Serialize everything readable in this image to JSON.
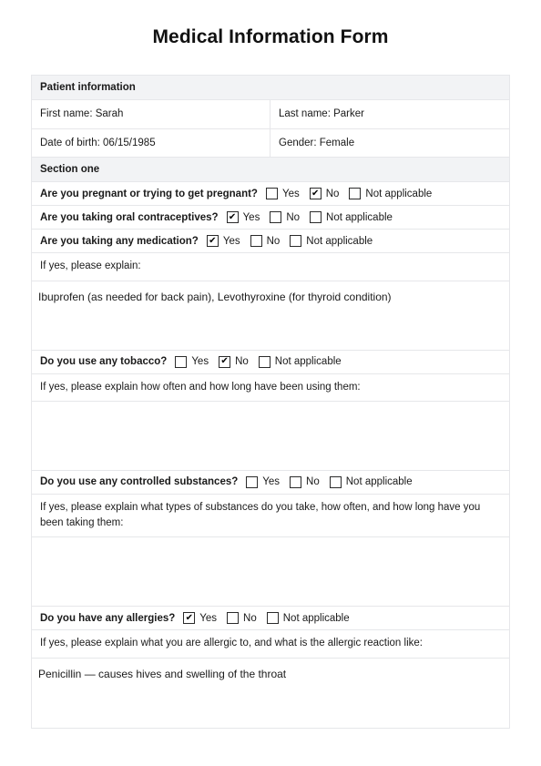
{
  "title": "Medical Information Form",
  "patient_section": {
    "header": "Patient information",
    "fields": [
      {
        "left": "First name: Sarah",
        "right": "Last name: Parker"
      },
      {
        "left": "Date of birth:  06/15/1985",
        "right": "Gender: Female"
      }
    ]
  },
  "section_one": {
    "header": "Section one",
    "option_labels": {
      "yes": "Yes",
      "no": "No",
      "na": "Not applicable"
    },
    "questions": [
      {
        "label": "Are you pregnant or trying to get pregnant?",
        "yes_checked": false,
        "no_checked": true,
        "na_checked": false
      },
      {
        "label": "Are you taking oral contraceptives?",
        "yes_checked": true,
        "no_checked": false,
        "na_checked": false
      },
      {
        "label": "Are you taking any medication?",
        "yes_checked": true,
        "no_checked": false,
        "na_checked": false
      },
      {
        "label": "Do you use any tobacco?",
        "yes_checked": false,
        "no_checked": true,
        "na_checked": false
      },
      {
        "label": "Do you use any controlled substances?",
        "yes_checked": false,
        "no_checked": false,
        "na_checked": false
      },
      {
        "label": "Do you have any allergies?",
        "yes_checked": true,
        "no_checked": false,
        "na_checked": false
      }
    ],
    "explanations": [
      {
        "prompt": "If yes, please explain:",
        "answer": "Ibuprofen (as needed for back pain), Levothyroxine (for thyroid condition)"
      },
      {
        "prompt": "If yes, please explain how often and how long have been using them:",
        "answer": ""
      },
      {
        "prompt": "If yes, please explain what types of substances do you take, how often, and how long have you been taking them:",
        "answer": ""
      },
      {
        "prompt": "If yes, please explain what you are allergic to, and what is the allergic reaction like:",
        "answer": "Penicillin — causes hives and swelling of the throat"
      }
    ]
  }
}
